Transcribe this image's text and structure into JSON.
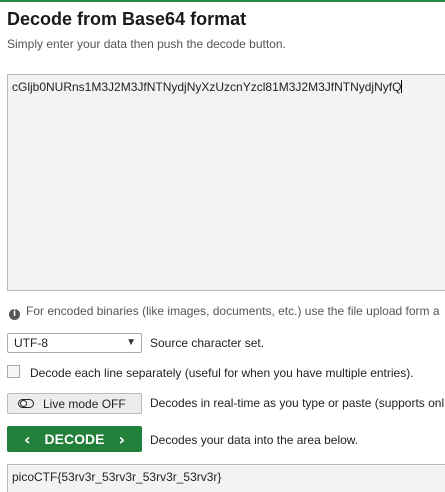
{
  "header": {
    "title": "Decode from Base64 format",
    "subtitle": "Simply enter your data then push the decode button."
  },
  "input": {
    "value": "cGljb0NURns1M3J2M3JfNTNydjNyXzUzcnYzcl81M3J2M3JfNTNydjNyfQ"
  },
  "hint": {
    "icon": "info-icon",
    "text": "For encoded binaries (like images, documents, etc.) use the file upload form a"
  },
  "charset": {
    "selected": "UTF-8",
    "label": "Source character set."
  },
  "each_line": {
    "checked": false,
    "label": "Decode each line separately (useful for when you have multiple entries)."
  },
  "live_mode": {
    "button_label": "Live mode OFF",
    "description": "Decodes in real-time as you type or paste (supports onl"
  },
  "decode": {
    "button_label": "DECODE",
    "description": "Decodes your data into the area below."
  },
  "output": {
    "value": "picoCTF{53rv3r_53rv3r_53rv3r_53rv3r}"
  },
  "colors": {
    "accent": "#23803a",
    "top_border": "#2a8a3e"
  }
}
